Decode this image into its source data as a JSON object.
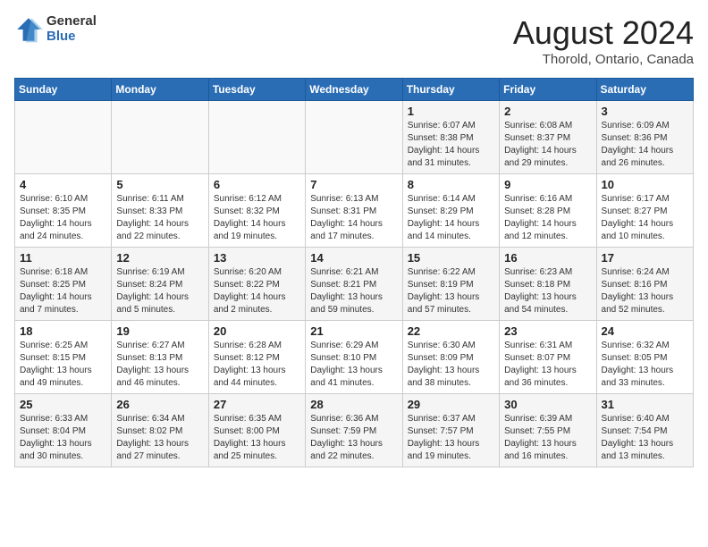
{
  "header": {
    "logo": {
      "general": "General",
      "blue": "Blue"
    },
    "title": "August 2024",
    "location": "Thorold, Ontario, Canada"
  },
  "weekdays": [
    "Sunday",
    "Monday",
    "Tuesday",
    "Wednesday",
    "Thursday",
    "Friday",
    "Saturday"
  ],
  "weeks": [
    [
      {
        "day": "",
        "info": ""
      },
      {
        "day": "",
        "info": ""
      },
      {
        "day": "",
        "info": ""
      },
      {
        "day": "",
        "info": ""
      },
      {
        "day": "1",
        "info": "Sunrise: 6:07 AM\nSunset: 8:38 PM\nDaylight: 14 hours\nand 31 minutes."
      },
      {
        "day": "2",
        "info": "Sunrise: 6:08 AM\nSunset: 8:37 PM\nDaylight: 14 hours\nand 29 minutes."
      },
      {
        "day": "3",
        "info": "Sunrise: 6:09 AM\nSunset: 8:36 PM\nDaylight: 14 hours\nand 26 minutes."
      }
    ],
    [
      {
        "day": "4",
        "info": "Sunrise: 6:10 AM\nSunset: 8:35 PM\nDaylight: 14 hours\nand 24 minutes."
      },
      {
        "day": "5",
        "info": "Sunrise: 6:11 AM\nSunset: 8:33 PM\nDaylight: 14 hours\nand 22 minutes."
      },
      {
        "day": "6",
        "info": "Sunrise: 6:12 AM\nSunset: 8:32 PM\nDaylight: 14 hours\nand 19 minutes."
      },
      {
        "day": "7",
        "info": "Sunrise: 6:13 AM\nSunset: 8:31 PM\nDaylight: 14 hours\nand 17 minutes."
      },
      {
        "day": "8",
        "info": "Sunrise: 6:14 AM\nSunset: 8:29 PM\nDaylight: 14 hours\nand 14 minutes."
      },
      {
        "day": "9",
        "info": "Sunrise: 6:16 AM\nSunset: 8:28 PM\nDaylight: 14 hours\nand 12 minutes."
      },
      {
        "day": "10",
        "info": "Sunrise: 6:17 AM\nSunset: 8:27 PM\nDaylight: 14 hours\nand 10 minutes."
      }
    ],
    [
      {
        "day": "11",
        "info": "Sunrise: 6:18 AM\nSunset: 8:25 PM\nDaylight: 14 hours\nand 7 minutes."
      },
      {
        "day": "12",
        "info": "Sunrise: 6:19 AM\nSunset: 8:24 PM\nDaylight: 14 hours\nand 5 minutes."
      },
      {
        "day": "13",
        "info": "Sunrise: 6:20 AM\nSunset: 8:22 PM\nDaylight: 14 hours\nand 2 minutes."
      },
      {
        "day": "14",
        "info": "Sunrise: 6:21 AM\nSunset: 8:21 PM\nDaylight: 13 hours\nand 59 minutes."
      },
      {
        "day": "15",
        "info": "Sunrise: 6:22 AM\nSunset: 8:19 PM\nDaylight: 13 hours\nand 57 minutes."
      },
      {
        "day": "16",
        "info": "Sunrise: 6:23 AM\nSunset: 8:18 PM\nDaylight: 13 hours\nand 54 minutes."
      },
      {
        "day": "17",
        "info": "Sunrise: 6:24 AM\nSunset: 8:16 PM\nDaylight: 13 hours\nand 52 minutes."
      }
    ],
    [
      {
        "day": "18",
        "info": "Sunrise: 6:25 AM\nSunset: 8:15 PM\nDaylight: 13 hours\nand 49 minutes."
      },
      {
        "day": "19",
        "info": "Sunrise: 6:27 AM\nSunset: 8:13 PM\nDaylight: 13 hours\nand 46 minutes."
      },
      {
        "day": "20",
        "info": "Sunrise: 6:28 AM\nSunset: 8:12 PM\nDaylight: 13 hours\nand 44 minutes."
      },
      {
        "day": "21",
        "info": "Sunrise: 6:29 AM\nSunset: 8:10 PM\nDaylight: 13 hours\nand 41 minutes."
      },
      {
        "day": "22",
        "info": "Sunrise: 6:30 AM\nSunset: 8:09 PM\nDaylight: 13 hours\nand 38 minutes."
      },
      {
        "day": "23",
        "info": "Sunrise: 6:31 AM\nSunset: 8:07 PM\nDaylight: 13 hours\nand 36 minutes."
      },
      {
        "day": "24",
        "info": "Sunrise: 6:32 AM\nSunset: 8:05 PM\nDaylight: 13 hours\nand 33 minutes."
      }
    ],
    [
      {
        "day": "25",
        "info": "Sunrise: 6:33 AM\nSunset: 8:04 PM\nDaylight: 13 hours\nand 30 minutes."
      },
      {
        "day": "26",
        "info": "Sunrise: 6:34 AM\nSunset: 8:02 PM\nDaylight: 13 hours\nand 27 minutes."
      },
      {
        "day": "27",
        "info": "Sunrise: 6:35 AM\nSunset: 8:00 PM\nDaylight: 13 hours\nand 25 minutes."
      },
      {
        "day": "28",
        "info": "Sunrise: 6:36 AM\nSunset: 7:59 PM\nDaylight: 13 hours\nand 22 minutes."
      },
      {
        "day": "29",
        "info": "Sunrise: 6:37 AM\nSunset: 7:57 PM\nDaylight: 13 hours\nand 19 minutes."
      },
      {
        "day": "30",
        "info": "Sunrise: 6:39 AM\nSunset: 7:55 PM\nDaylight: 13 hours\nand 16 minutes."
      },
      {
        "day": "31",
        "info": "Sunrise: 6:40 AM\nSunset: 7:54 PM\nDaylight: 13 hours\nand 13 minutes."
      }
    ]
  ]
}
